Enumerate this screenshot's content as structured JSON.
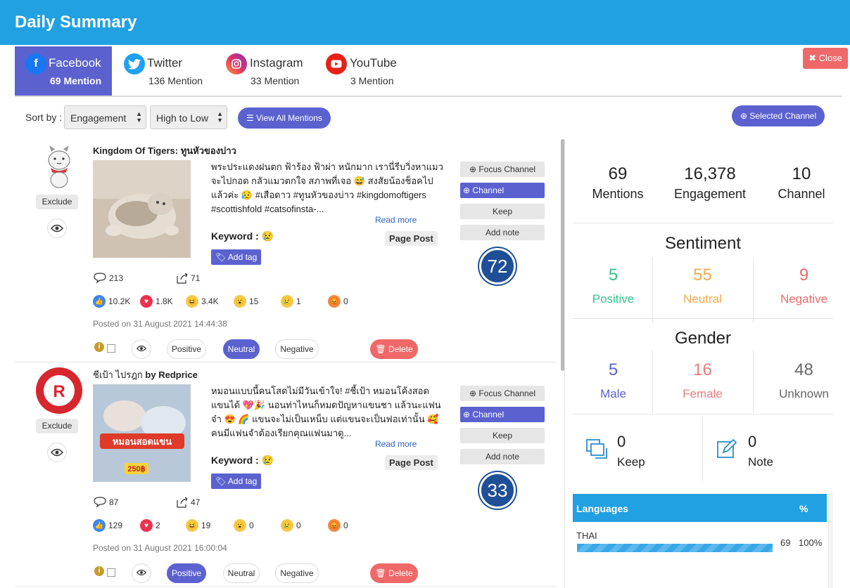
{
  "header": {
    "title": "Daily Summary",
    "close_label": "Close",
    "close_icon": "✖"
  },
  "tabs": [
    {
      "name": "Facebook",
      "count": "69 Mention",
      "icon": "facebook-icon",
      "color": "#1877f2",
      "active": true
    },
    {
      "name": "Twitter",
      "count": "136 Mention",
      "icon": "twitter-icon",
      "color": "#1da1f2",
      "active": false
    },
    {
      "name": "Instagram",
      "count": "33 Mention",
      "icon": "instagram-icon",
      "color": "#c13584",
      "active": false
    },
    {
      "name": "YouTube",
      "count": "3 Mention",
      "icon": "youtube-icon",
      "color": "#e62117",
      "active": false
    }
  ],
  "sort": {
    "label": "Sort by :",
    "field": "Engagement",
    "order": "High to Low",
    "view_all": "View All Mentions",
    "selected_channel": "Selected Channel"
  },
  "posts": [
    {
      "title": "Kingdom Of Tigers: ทูนหัวของบ่าว",
      "text": "พระประแดงฝนตก ฟ้าร้อง ฟ้าผ่า หนักมาก เรานี่รีบวิ่งหาแมวจะไปกอด กลัวแมวตกใจ สภาพที่เจอ 😅 สงสัยน้องช็อคไปแล้วค่ะ 😥 #เสือดาว #ทูนหัวของบ่าว #kingdomoftigers #scottishfold #catsofinsta-...",
      "read_more": "Read more",
      "keyword_label": "Keyword :",
      "keyword_emoji": "😢",
      "post_type": "Page Post",
      "add_tag": "Add tag",
      "exclude": "Exclude",
      "focus_channel": "Focus Channel",
      "channel": "Channel",
      "keep": "Keep",
      "add_note": "Add note",
      "score": "72",
      "comments": "213",
      "shares": "71",
      "reactions": [
        "10.2K",
        "1.8K",
        "3.4K",
        "15",
        "1",
        "0"
      ],
      "posted": "Posted on 31 August 2021 14:44:38",
      "sentiment": [
        "Positive",
        "Neutral",
        "Negative"
      ],
      "selected_sentiment": "Neutral",
      "delete": "Delete"
    },
    {
      "title_main": "ชีเป้า ไปรฎก",
      "title_by": " by Redprice",
      "text": "หมอนแบบนี้คนโสดไม่มีวันเข้าใจ! #ชี้เป้า หมอนโค้งสอดแขนได้ 💖🎉 นอนท่าไหนก็หมดปัญหาแขนชา แล้วนะแฟนจ๋า 😍 🌈 แขนจะไม่เป็นเหน็บ แต่แขนจะเป็นฟอเท่านั้น 🥰 คนมีแฟนจำต้องเรียกคุณแฟนมาดู...",
      "read_more": "Read more",
      "keyword_label": "Keyword :",
      "keyword_emoji": "😢",
      "post_type": "Page Post",
      "add_tag": "Add tag",
      "exclude": "Exclude",
      "focus_channel": "Focus Channel",
      "channel": "Channel",
      "keep": "Keep",
      "add_note": "Add note",
      "score": "33",
      "comments": "87",
      "shares": "47",
      "reactions": [
        "129",
        "2",
        "19",
        "0",
        "0",
        "0"
      ],
      "posted": "Posted on 31 August 2021 16:00:04",
      "sentiment": [
        "Positive",
        "Neutral",
        "Negative"
      ],
      "selected_sentiment": "Positive",
      "delete": "Delete",
      "image_text": {
        "top": "หมอนสอดแขน",
        "price": "250฿"
      }
    }
  ],
  "summary": {
    "totals": [
      {
        "value": "69",
        "label": "Mentions"
      },
      {
        "value": "16,378",
        "label": "Engagement"
      },
      {
        "value": "10",
        "label": "Channel"
      }
    ],
    "sentiment_title": "Sentiment",
    "sentiment": [
      {
        "value": "5",
        "label": "Positive",
        "color": "#35c28a"
      },
      {
        "value": "55",
        "label": "Neutral",
        "color": "#f5a84a"
      },
      {
        "value": "9",
        "label": "Negative",
        "color": "#f06868"
      }
    ],
    "gender_title": "Gender",
    "gender": [
      {
        "value": "5",
        "label": "Male",
        "color": "#5b62cf"
      },
      {
        "value": "16",
        "label": "Female",
        "color": "#f07a7a"
      },
      {
        "value": "48",
        "label": "Unknown",
        "color": "#666666"
      }
    ],
    "keep": {
      "value": "0",
      "label": "Keep"
    },
    "note": {
      "value": "0",
      "label": "Note"
    },
    "languages": {
      "header": "Languages",
      "pct_header": "%",
      "rows": [
        {
          "name": "THAI",
          "count": "69",
          "pct": "100%",
          "fill": 1.0
        }
      ]
    }
  }
}
